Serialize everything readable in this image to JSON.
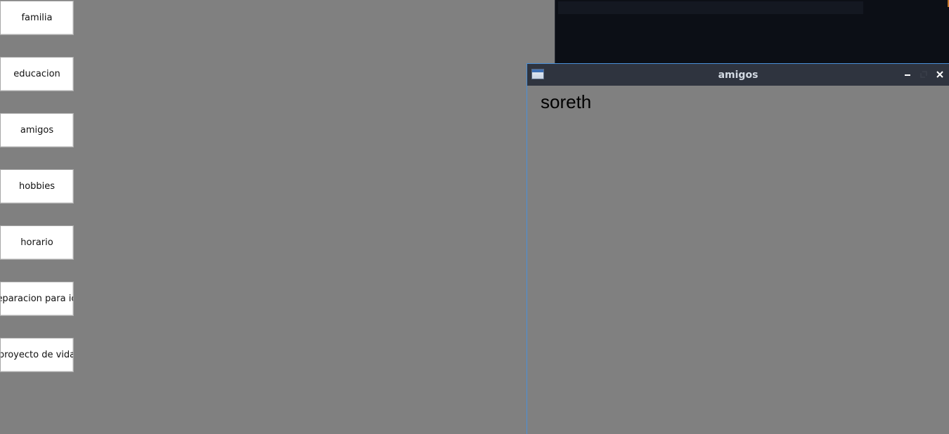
{
  "nav_buttons": [
    {
      "label": "familia"
    },
    {
      "label": "educacion"
    },
    {
      "label": "amigos"
    },
    {
      "label": "hobbies"
    },
    {
      "label": "horario"
    },
    {
      "label": "eparacion para ict"
    },
    {
      "label": "proyecto de vida"
    }
  ],
  "window": {
    "title": "amigos",
    "body_text": "soreth",
    "icons": {
      "app": "app-window-icon",
      "minimize": "minimize-icon",
      "maximize": "maximize-icon",
      "close": "close-icon"
    }
  },
  "colors": {
    "desktop_bg": "#808080",
    "titlebar_bg": "#2f343f",
    "title_text": "#d3dae3",
    "window_border": "#4a90d9",
    "background_window": "#0c0f16"
  }
}
